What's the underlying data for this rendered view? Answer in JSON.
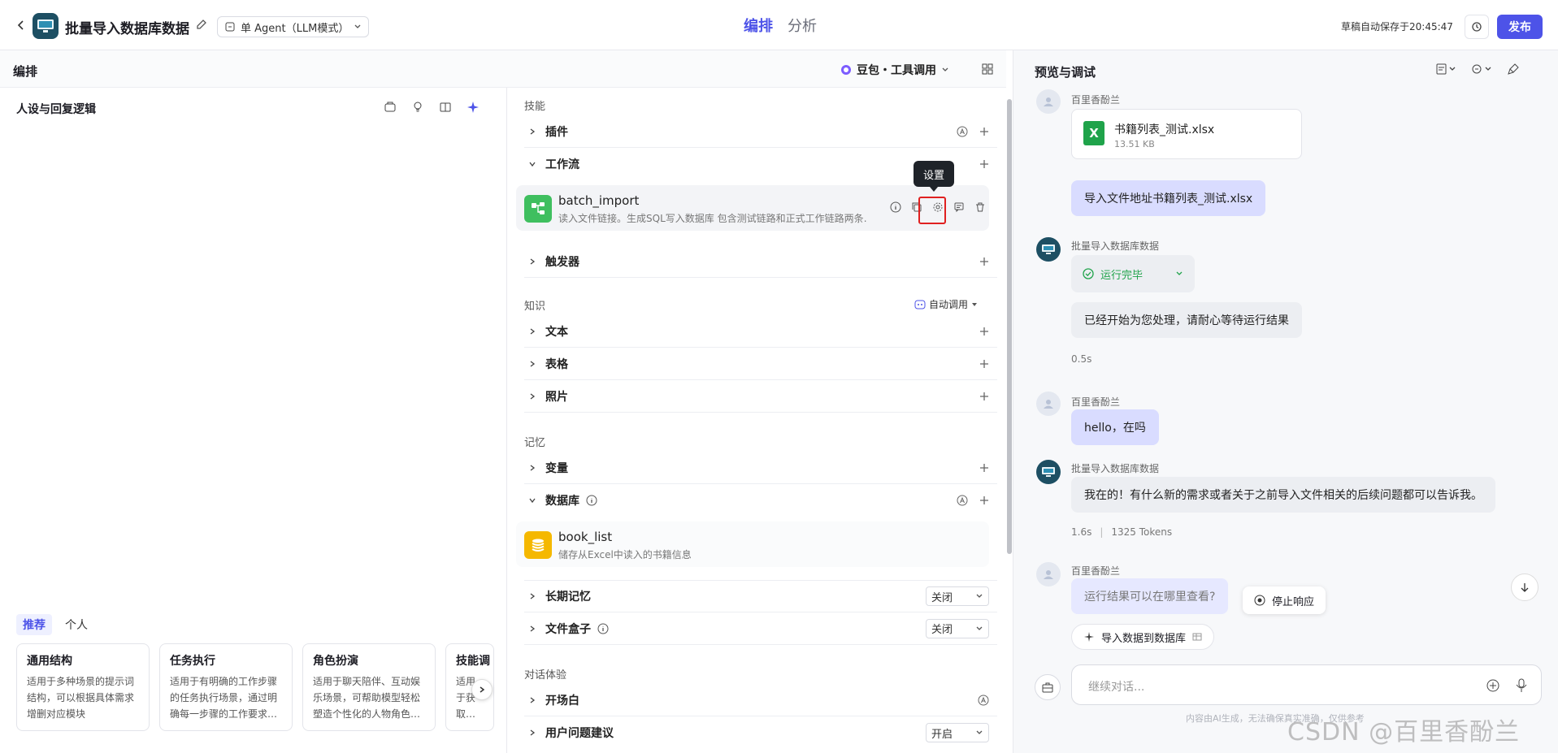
{
  "topbar": {
    "title": "批量导入数据库数据",
    "mode": "单 Agent（LLM模式）",
    "tabs": [
      "编排",
      "分析"
    ],
    "autosave": "草稿自动保存于20:45:47",
    "publish": "发布"
  },
  "edit_header": {
    "label": "编排",
    "model": "豆包・工具调用"
  },
  "persona": {
    "title": "人设与回复逻辑",
    "prompt_tabs": [
      "推荐",
      "个人"
    ],
    "cards": [
      {
        "title": "通用结构",
        "desc": "适用于多种场景的提示词结构，可以根据具体需求增删对应模块"
      },
      {
        "title": "任务执行",
        "desc": "适用于有明确的工作步骤的任务执行场景，通过明确每一步骤的工作要求…"
      },
      {
        "title": "角色扮演",
        "desc": "适用于聊天陪伴、互动娱乐场景，可帮助模型轻松塑造个性化的人物角色…"
      },
      {
        "title": "技能调",
        "desc": "适用于获取…的场景…"
      }
    ]
  },
  "skills": {
    "section_skills": "技能",
    "plugin": "插件",
    "workflow": "工作流",
    "workflow_item": {
      "name": "batch_import",
      "desc": "读入文件链接。生成SQL写入数据库 包含测试链路和正式工作链路两条…"
    },
    "tooltip": "设置",
    "trigger": "触发器",
    "section_knowledge": "知识",
    "auto_call": "自动调用",
    "text": "文本",
    "table": "表格",
    "photo": "照片",
    "section_memory": "记忆",
    "variable": "变量",
    "database": "数据库",
    "db_item": {
      "name": "book_list",
      "desc": "储存从Excel中读入的书籍信息"
    },
    "long_memory": "长期记忆",
    "long_memory_value": "关闭",
    "filebox": "文件盒子",
    "filebox_value": "关闭",
    "section_dialog": "对话体验",
    "opening": "开场白",
    "suggestion": "用户问题建议",
    "suggestion_value": "开启"
  },
  "preview": {
    "title": "预览与调试",
    "messages": {
      "user_name": "百里香酚兰",
      "bot_name": "批量导入数据库数据",
      "file_name": "书籍列表_测试.xlsx",
      "file_size": "13.51 KB",
      "m1": "导入文件地址书籍列表_测试.xlsx",
      "run_status": "运行完毕",
      "m2": "已经开始为您处理，请耐心等待运行结果",
      "t2": "0.5s",
      "m3": "hello，在吗",
      "m4": "我在的！有什么新的需求或者关于之前导入文件相关的后续问题都可以告诉我。",
      "t4": "1.6s",
      "tokens": "1325 Tokens",
      "m5": "运行结果可以在哪里查看?",
      "stop": "停止响应",
      "shortcut": "导入数据到数据库"
    },
    "input_placeholder": "继续对话...",
    "disclaimer": "内容由AI生成，无法确保真实准确，仅供参考"
  },
  "watermark": "CSDN @百里香酚兰",
  "colors": {
    "accent": "#4d53e8",
    "user_bubble": "#d9dcff",
    "success": "#1fa34a",
    "highlight": "#e02020"
  }
}
